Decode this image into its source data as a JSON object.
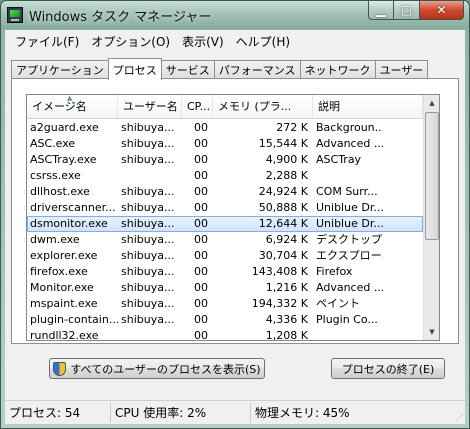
{
  "window": {
    "title": "Windows タスク マネージャー",
    "minimize_label": "▁",
    "maximize_label": "□",
    "close_label": "✕"
  },
  "menu": [
    "ファイル(F)",
    "オプション(O)",
    "表示(V)",
    "ヘルプ(H)"
  ],
  "tabs": [
    {
      "label": "アプリケーション",
      "active": false
    },
    {
      "label": "プロセス",
      "active": true
    },
    {
      "label": "サービス",
      "active": false
    },
    {
      "label": "パフォーマンス",
      "active": false
    },
    {
      "label": "ネットワーク",
      "active": false
    },
    {
      "label": "ユーザー",
      "active": false
    }
  ],
  "columns": {
    "name": "イメージ名",
    "user": "ユーザー名",
    "cpu": "CP...",
    "memory": "メモリ (プラ...",
    "description": "説明"
  },
  "processes": [
    {
      "name": "a2guard.exe",
      "user": "shibuya...",
      "cpu": "00",
      "memory": "272 K",
      "desc": "Backgroun..."
    },
    {
      "name": "ASC.exe",
      "user": "shibuya...",
      "cpu": "00",
      "memory": "15,544 K",
      "desc": "Advanced ..."
    },
    {
      "name": "ASCTray.exe",
      "user": "shibuya...",
      "cpu": "00",
      "memory": "4,900 K",
      "desc": "ASCTray"
    },
    {
      "name": "csrss.exe",
      "user": "",
      "cpu": "00",
      "memory": "2,288 K",
      "desc": ""
    },
    {
      "name": "dllhost.exe",
      "user": "shibuya...",
      "cpu": "00",
      "memory": "24,924 K",
      "desc": "COM Surr..."
    },
    {
      "name": "driverscanner...",
      "user": "shibuya...",
      "cpu": "00",
      "memory": "50,888 K",
      "desc": "Uniblue Dr..."
    },
    {
      "name": "dsmonitor.exe",
      "user": "shibuya...",
      "cpu": "00",
      "memory": "12,644 K",
      "desc": "Uniblue Dr...",
      "selected": true
    },
    {
      "name": "dwm.exe",
      "user": "shibuya...",
      "cpu": "00",
      "memory": "6,924 K",
      "desc": "デスクトップ..."
    },
    {
      "name": "explorer.exe",
      "user": "shibuya...",
      "cpu": "00",
      "memory": "30,704 K",
      "desc": "エクスプロー..."
    },
    {
      "name": "firefox.exe",
      "user": "shibuya...",
      "cpu": "00",
      "memory": "143,408 K",
      "desc": "Firefox"
    },
    {
      "name": "Monitor.exe",
      "user": "shibuya...",
      "cpu": "00",
      "memory": "1,216 K",
      "desc": "Advanced ..."
    },
    {
      "name": "mspaint.exe",
      "user": "shibuya...",
      "cpu": "00",
      "memory": "194,332 K",
      "desc": "ペイント"
    },
    {
      "name": "plugin-contain...",
      "user": "shibuya...",
      "cpu": "00",
      "memory": "4,336 K",
      "desc": "Plugin Co..."
    },
    {
      "name": "rundll32.exe",
      "user": "",
      "cpu": "00",
      "memory": "1,208 K",
      "desc": ""
    }
  ],
  "buttons": {
    "show_all": "すべてのユーザーのプロセスを表示(S)",
    "end_process": "プロセスの終了(E)"
  },
  "status": {
    "processes": "プロセス: 54",
    "cpu": "CPU 使用率: 2%",
    "memory": "物理メモリ: 45%"
  }
}
